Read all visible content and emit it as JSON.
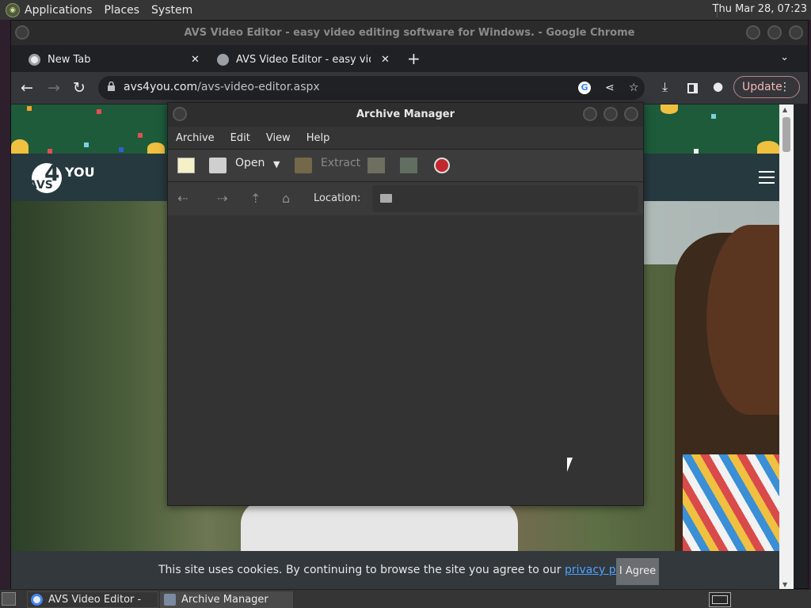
{
  "top_panel": {
    "menus": [
      "Applications",
      "Places",
      "System"
    ],
    "clock": "Thu Mar 28, 07:23"
  },
  "chrome": {
    "window_title": "AVS Video Editor - easy video editing software for Windows. - Google Chrome",
    "tabs": [
      {
        "label": "New Tab",
        "active": true
      },
      {
        "label": "AVS Video Editor - easy video",
        "active": false
      }
    ],
    "url_host": "avs4you.com",
    "url_path": "/avs-video-editor.aspx",
    "update_label": "Update"
  },
  "page": {
    "logo": {
      "digit": "4",
      "avs": "AVS",
      "you": "YOU"
    },
    "cookie_text": "This site uses cookies. By continuing to browse the site you agree to our ",
    "privacy_link": "privacy policy",
    "cookie_period": ".",
    "agree_label": "I Agree"
  },
  "archive_manager": {
    "title": "Archive Manager",
    "menus": [
      "Archive",
      "Edit",
      "View",
      "Help"
    ],
    "toolbar": {
      "open_label": "Open",
      "extract_label": "Extract"
    },
    "location_label": "Location:"
  },
  "taskbar": {
    "items": [
      {
        "label": "AVS Video Editor - e..."
      },
      {
        "label": "Archive Manager"
      }
    ]
  },
  "colors": {
    "update_accent": "#f2b8b5",
    "link": "#4aa3ff",
    "record_red": "#c0282d"
  }
}
